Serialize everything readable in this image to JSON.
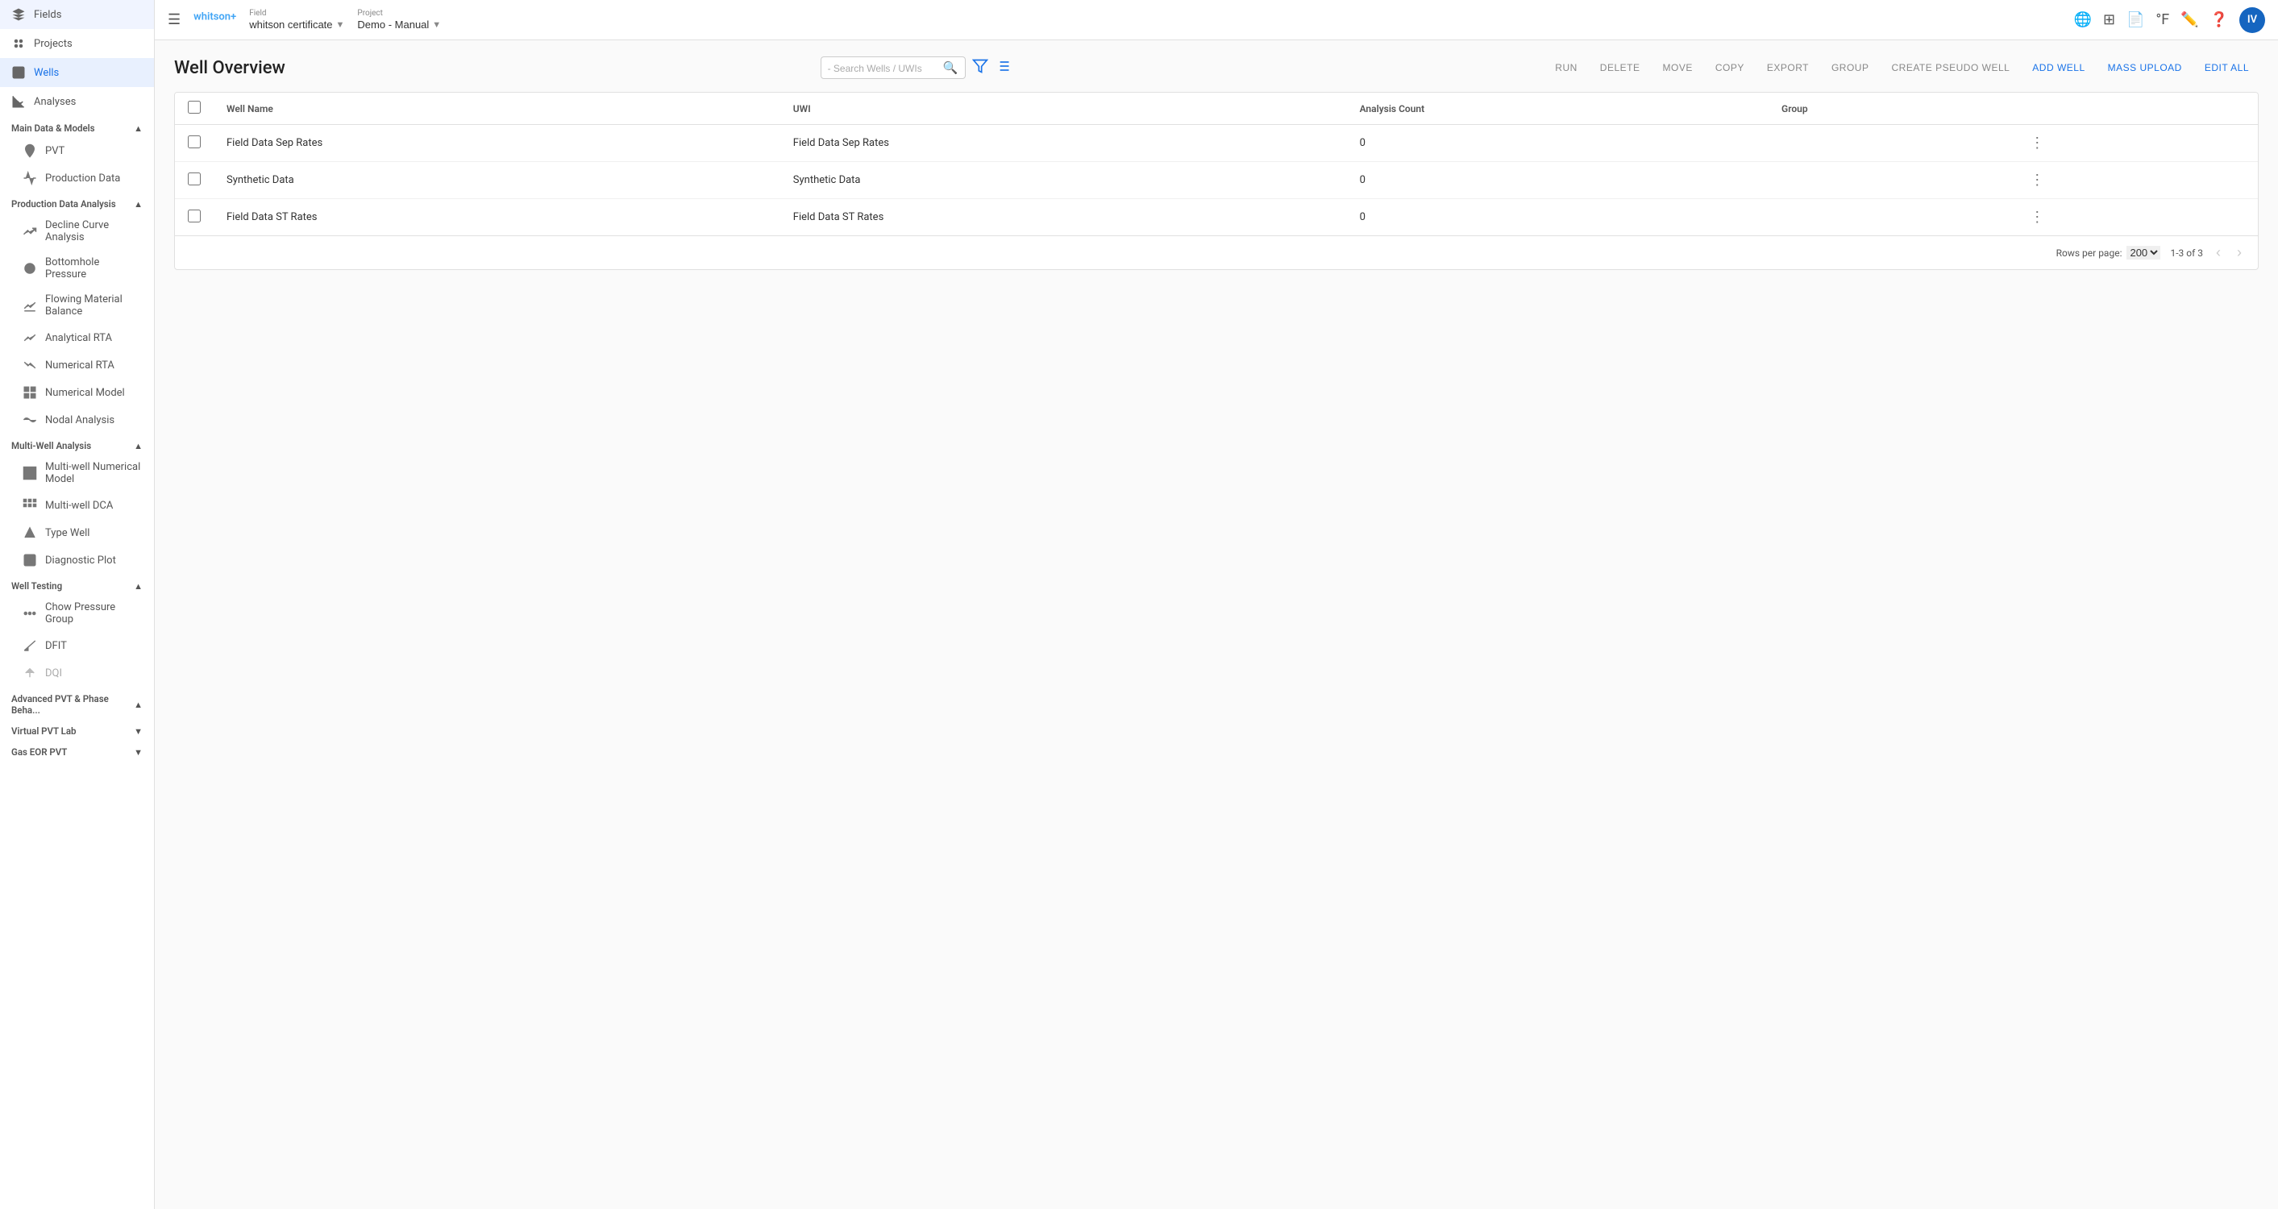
{
  "app": {
    "name": "whitson",
    "name_superscript": "+",
    "avatar_initials": "IV"
  },
  "topbar": {
    "menu_icon": "☰",
    "field_label": "Field",
    "field_value": "whitson certificate",
    "project_label": "Project",
    "project_value": "Demo - Manual"
  },
  "sidebar": {
    "nav_items": [
      {
        "id": "fields",
        "label": "Fields",
        "icon": "⬡"
      },
      {
        "id": "projects",
        "label": "Projects",
        "icon": "⬡"
      },
      {
        "id": "wells",
        "label": "Wells",
        "icon": "⬡",
        "active": true
      }
    ],
    "main_data_models": {
      "header": "Main Data & Models",
      "items": [
        {
          "id": "pvt",
          "label": "PVT",
          "icon": "person"
        },
        {
          "id": "production-data",
          "label": "Production Data",
          "icon": "chart-line"
        }
      ]
    },
    "production_data_analysis": {
      "header": "Production Data Analysis",
      "items": [
        {
          "id": "decline-curve-analysis",
          "label": "Decline Curve Analysis",
          "icon": "decline"
        },
        {
          "id": "bottomhole-pressure",
          "label": "Bottomhole Pressure",
          "icon": "circle-dash"
        },
        {
          "id": "flowing-material-balance",
          "label": "Flowing Material Balance",
          "icon": "chart-area"
        },
        {
          "id": "analytical-rta",
          "label": "Analytical RTA",
          "icon": "chart-up"
        },
        {
          "id": "numerical-rta",
          "label": "Numerical RTA",
          "icon": "chart-down"
        },
        {
          "id": "numerical-model",
          "label": "Numerical Model",
          "icon": "grid"
        },
        {
          "id": "nodal-analysis",
          "label": "Nodal Analysis",
          "icon": "wave"
        }
      ]
    },
    "multi_well_analysis": {
      "header": "Multi-Well Analysis",
      "items": [
        {
          "id": "multi-well-numerical-model",
          "label": "Multi-well Numerical Model",
          "icon": "grid2"
        },
        {
          "id": "multi-well-dca",
          "label": "Multi-well DCA",
          "icon": "squares"
        },
        {
          "id": "type-well",
          "label": "Type Well",
          "icon": "triangle-chart"
        },
        {
          "id": "diagnostic-plot",
          "label": "Diagnostic Plot",
          "icon": "bar-chart"
        }
      ]
    },
    "well_testing": {
      "header": "Well Testing",
      "items": [
        {
          "id": "chow-pressure-group",
          "label": "Chow Pressure Group",
          "icon": "nodes"
        },
        {
          "id": "dfit",
          "label": "DFIT",
          "icon": "angle-chart"
        },
        {
          "id": "dqi",
          "label": "DQI",
          "icon": "angle-up",
          "disabled": true
        }
      ]
    },
    "advanced_pvt": {
      "header": "Advanced PVT & Phase Beha...",
      "collapsed": false
    },
    "virtual_pvt_lab": {
      "header": "Virtual PVT Lab",
      "collapsed": true
    },
    "gas_eor_pvt": {
      "header": "Gas EOR PVT",
      "collapsed": true
    }
  },
  "well_overview": {
    "title": "Well Overview",
    "search_placeholder": "- Search Wells / UWIs",
    "actions": {
      "run": "RUN",
      "delete": "DELETE",
      "move": "MOVE",
      "copy": "COPY",
      "export": "EXPORT",
      "group": "GROUP",
      "create_pseudo_well": "CREATE PSEUDO WELL",
      "add_well": "ADD WELL",
      "mass_upload": "MASS UPLOAD",
      "edit_all": "EDIT ALL"
    },
    "table": {
      "columns": [
        {
          "id": "checkbox",
          "label": ""
        },
        {
          "id": "well_name",
          "label": "Well Name"
        },
        {
          "id": "uwi",
          "label": "UWI"
        },
        {
          "id": "analysis_count",
          "label": "Analysis Count"
        },
        {
          "id": "group",
          "label": "Group"
        },
        {
          "id": "menu",
          "label": ""
        }
      ],
      "rows": [
        {
          "id": 1,
          "well_name": "Field Data Sep Rates",
          "uwi": "Field Data Sep Rates",
          "analysis_count": "0",
          "group": ""
        },
        {
          "id": 2,
          "well_name": "Synthetic Data",
          "uwi": "Synthetic Data",
          "analysis_count": "0",
          "group": ""
        },
        {
          "id": 3,
          "well_name": "Field Data ST Rates",
          "uwi": "Field Data ST Rates",
          "analysis_count": "0",
          "group": ""
        }
      ]
    },
    "pagination": {
      "rows_per_page_label": "Rows per page:",
      "rows_per_page_value": "200",
      "range": "1-3 of 3"
    }
  }
}
